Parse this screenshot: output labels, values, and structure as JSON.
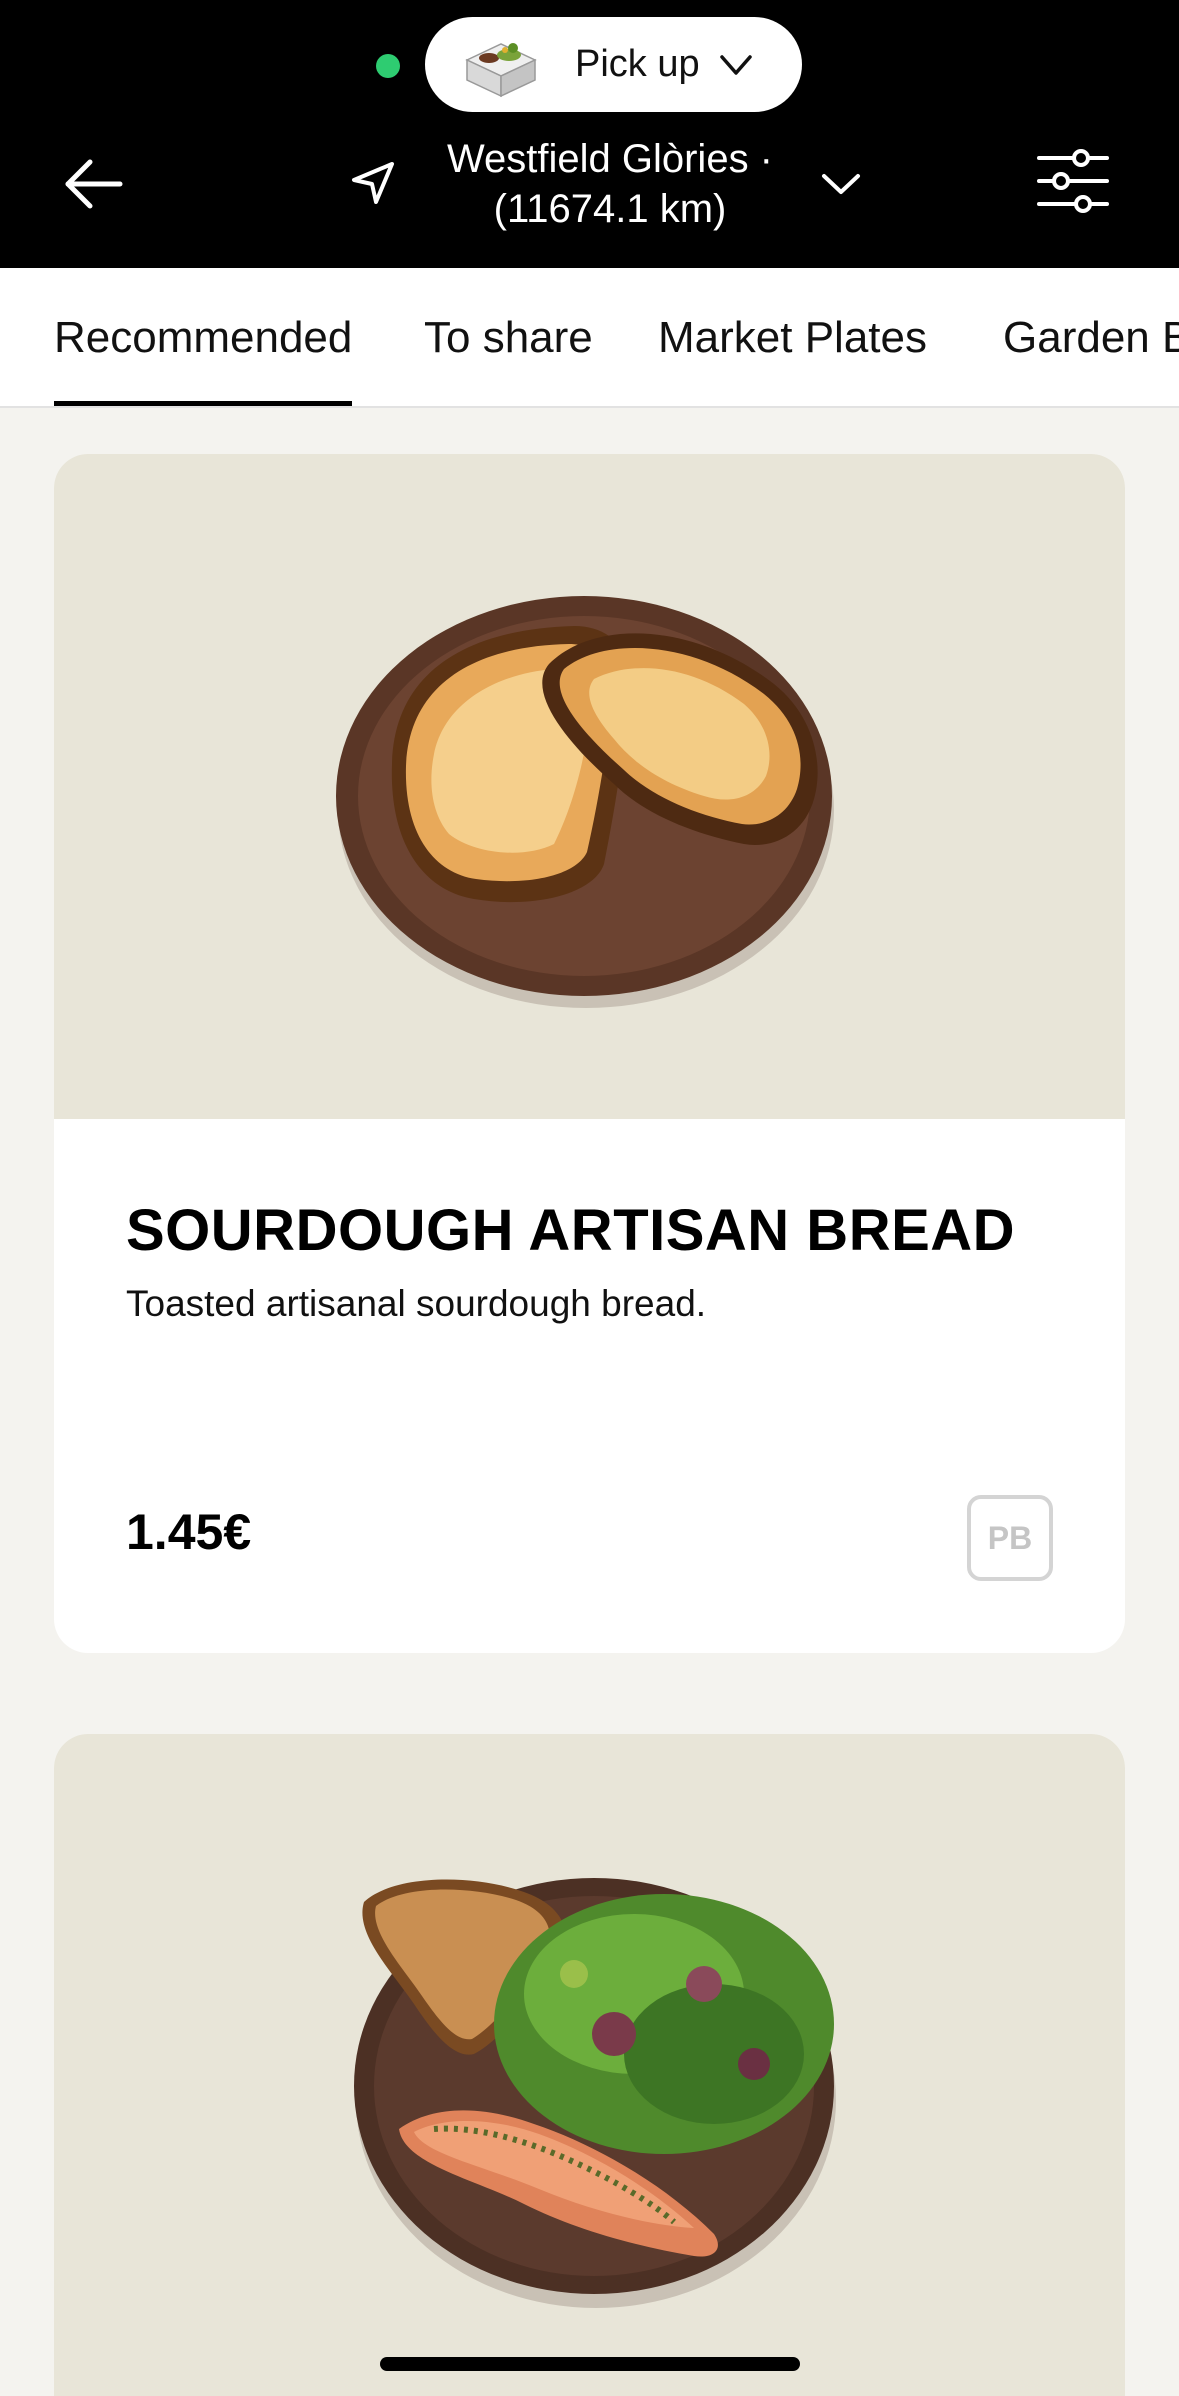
{
  "header": {
    "mode_label": "Pick up",
    "location_line1": "Westfield Glòries ·",
    "location_line2": "(11674.1 km)"
  },
  "tabs": [
    {
      "label": "Recommended",
      "active": true
    },
    {
      "label": "To share",
      "active": false
    },
    {
      "label": "Market Plates",
      "active": false
    },
    {
      "label": "Garden Bowls",
      "active": false
    }
  ],
  "products": [
    {
      "title": "SOURDOUGH ARTISAN BREAD",
      "description": "Toasted artisanal sourdough bread.",
      "price": "1.45€",
      "badge": "PB"
    },
    {
      "title": "",
      "description": "",
      "price": "",
      "badge": ""
    }
  ],
  "colors": {
    "header_bg": "#000000",
    "status_online": "#2ecc71",
    "photo_bg": "#e8e5d8",
    "page_bg": "#f4f3ef"
  }
}
